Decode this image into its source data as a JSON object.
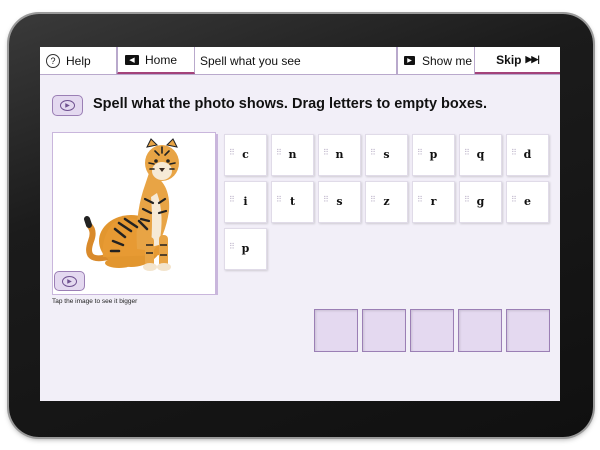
{
  "header": {
    "help_label": "Help",
    "home_label": "Home",
    "activity_title": "Spell what you see",
    "show_me_label": "Show me",
    "skip_label": "Skip"
  },
  "instruction": "Spell what the photo shows. Drag letters to empty boxes.",
  "photo": {
    "caption": "Tap the image to see it bigger",
    "subject_icon": "tiger-photo"
  },
  "letter_tiles": [
    "c",
    "n",
    "n",
    "s",
    "p",
    "q",
    "d",
    "i",
    "t",
    "s",
    "z",
    "r",
    "g",
    "e",
    "p"
  ],
  "answer_slots": [
    "",
    "",
    "",
    "",
    ""
  ],
  "colors": {
    "accent": "#a3427a",
    "slot_fill": "#e4d9f0",
    "screen_bg": "#f2eff8"
  }
}
